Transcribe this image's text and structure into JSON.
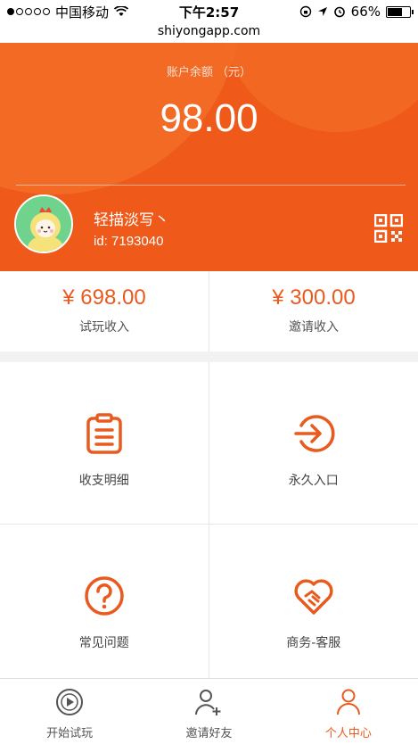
{
  "status_bar": {
    "carrier": "中国移动",
    "time": "下午2:57",
    "battery": "66%",
    "battery_level": 0.66
  },
  "url": "shiyongapp.com",
  "account": {
    "balance_label": "账户余额 （元）",
    "balance": "98.00",
    "username": "轻描淡写丶",
    "user_id": "id: 7193040"
  },
  "income": [
    {
      "amount": "¥ 698.00",
      "label": "试玩收入"
    },
    {
      "amount": "¥ 300.00",
      "label": "邀请收入"
    }
  ],
  "menu": [
    {
      "label": "收支明细",
      "icon": "clipboard-list-icon"
    },
    {
      "label": "永久入口",
      "icon": "enter-circle-icon"
    },
    {
      "label": "常见问题",
      "icon": "question-circle-icon"
    },
    {
      "label": "商务-客服",
      "icon": "handshake-heart-icon"
    }
  ],
  "tabs": [
    {
      "label": "开始试玩",
      "icon": "play-circle-icon",
      "active": false
    },
    {
      "label": "邀请好友",
      "icon": "add-user-icon",
      "active": false
    },
    {
      "label": "个人中心",
      "icon": "user-icon",
      "active": true
    }
  ],
  "colors": {
    "accent": "#ef5a1b",
    "inactive": "#555555"
  }
}
